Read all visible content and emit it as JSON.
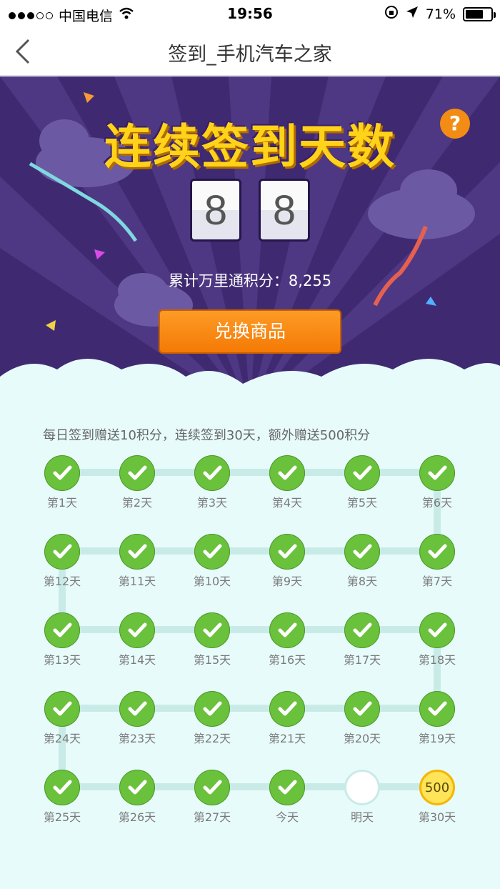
{
  "status": {
    "carrier": "中国电信",
    "time": "19:56",
    "battery": "71%"
  },
  "nav": {
    "title": "签到_手机汽车之家"
  },
  "hero": {
    "headline": "连续签到天数",
    "help": "?",
    "digits": [
      "8",
      "8"
    ],
    "points_text": "累计万里通积分：8,255",
    "exchange_label": "兑换商品"
  },
  "rule_text": "每日签到赠送10积分，连续签到30天，额外赠送500积分",
  "days": [
    {
      "label": "第1天",
      "state": "done"
    },
    {
      "label": "第2天",
      "state": "done"
    },
    {
      "label": "第3天",
      "state": "done"
    },
    {
      "label": "第4天",
      "state": "done"
    },
    {
      "label": "第5天",
      "state": "done"
    },
    {
      "label": "第6天",
      "state": "done"
    },
    {
      "label": "第12天",
      "state": "done"
    },
    {
      "label": "第11天",
      "state": "done"
    },
    {
      "label": "第10天",
      "state": "done"
    },
    {
      "label": "第9天",
      "state": "done"
    },
    {
      "label": "第8天",
      "state": "done"
    },
    {
      "label": "第7天",
      "state": "done"
    },
    {
      "label": "第13天",
      "state": "done"
    },
    {
      "label": "第14天",
      "state": "done"
    },
    {
      "label": "第15天",
      "state": "done"
    },
    {
      "label": "第16天",
      "state": "done"
    },
    {
      "label": "第17天",
      "state": "done"
    },
    {
      "label": "第18天",
      "state": "done"
    },
    {
      "label": "第24天",
      "state": "done"
    },
    {
      "label": "第23天",
      "state": "done"
    },
    {
      "label": "第22天",
      "state": "done"
    },
    {
      "label": "第21天",
      "state": "done"
    },
    {
      "label": "第20天",
      "state": "done"
    },
    {
      "label": "第19天",
      "state": "done"
    },
    {
      "label": "第25天",
      "state": "done"
    },
    {
      "label": "第26天",
      "state": "done"
    },
    {
      "label": "第27天",
      "state": "done"
    },
    {
      "label": "今天",
      "state": "done"
    },
    {
      "label": "明天",
      "state": "empty"
    },
    {
      "label": "第30天",
      "state": "reward",
      "reward": "500"
    }
  ]
}
